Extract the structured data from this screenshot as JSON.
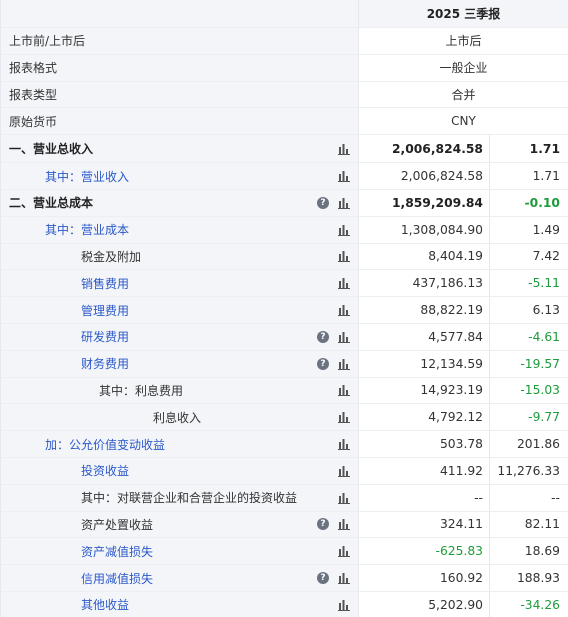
{
  "header": {
    "period": "2025 三季报"
  },
  "info_rows": [
    {
      "label": "上市前/上市后",
      "value": "上市后"
    },
    {
      "label": "报表格式",
      "value": "一般企业"
    },
    {
      "label": "报表类型",
      "value": "合并"
    },
    {
      "label": "原始货币",
      "value": "CNY"
    }
  ],
  "icons": {
    "chart": "bar-chart-icon",
    "help": "question-icon"
  },
  "colors": {
    "link": "#2b58c9",
    "negative": "#1e9b3a",
    "label_bg": "#f3f5f9"
  },
  "rows": [
    {
      "label": "一、营业总收入",
      "value": "2,006,824.58",
      "yoy": "1.71",
      "indent": 8,
      "style": "bold",
      "help": false,
      "neg": false
    },
    {
      "label": "其中：营业收入",
      "value": "2,006,824.58",
      "yoy": "1.71",
      "indent": 44,
      "style": "blue",
      "help": false,
      "neg": false
    },
    {
      "label": "二、营业总成本",
      "value": "1,859,209.84",
      "yoy": "-0.10",
      "indent": 8,
      "style": "bold",
      "help": true,
      "neg": true
    },
    {
      "label": "其中：营业成本",
      "value": "1,308,084.90",
      "yoy": "1.49",
      "indent": 44,
      "style": "blue",
      "help": false,
      "neg": false
    },
    {
      "label": "税金及附加",
      "value": "8,404.19",
      "yoy": "7.42",
      "indent": 80,
      "style": "plain",
      "help": false,
      "neg": false
    },
    {
      "label": "销售费用",
      "value": "437,186.13",
      "yoy": "-5.11",
      "indent": 80,
      "style": "blue",
      "help": false,
      "neg": true
    },
    {
      "label": "管理费用",
      "value": "88,822.19",
      "yoy": "6.13",
      "indent": 80,
      "style": "blue",
      "help": false,
      "neg": false
    },
    {
      "label": "研发费用",
      "value": "4,577.84",
      "yoy": "-4.61",
      "indent": 80,
      "style": "blue",
      "help": true,
      "neg": true
    },
    {
      "label": "财务费用",
      "value": "12,134.59",
      "yoy": "-19.57",
      "indent": 80,
      "style": "blue",
      "help": true,
      "neg": true
    },
    {
      "label": "其中：利息费用",
      "value": "14,923.19",
      "yoy": "-15.03",
      "indent": 98,
      "style": "plain",
      "help": false,
      "neg": true
    },
    {
      "label": "利息收入",
      "value": "4,792.12",
      "yoy": "-9.77",
      "indent": 152,
      "style": "plain",
      "help": false,
      "neg": true
    },
    {
      "label": "加：公允价值变动收益",
      "value": "503.78",
      "yoy": "201.86",
      "indent": 44,
      "style": "blue",
      "help": false,
      "neg": false
    },
    {
      "label": "投资收益",
      "value": "411.92",
      "yoy": "11,276.33",
      "indent": 80,
      "style": "blue",
      "help": false,
      "neg": false
    },
    {
      "label": "其中：对联营企业和合营企业的投资收益",
      "value": "--",
      "yoy": "--",
      "indent": 80,
      "style": "plain",
      "help": false,
      "neg": false
    },
    {
      "label": "资产处置收益",
      "value": "324.11",
      "yoy": "82.11",
      "indent": 80,
      "style": "plain",
      "help": true,
      "neg": false
    },
    {
      "label": "资产减值损失",
      "value": "-625.83",
      "yoy": "18.69",
      "indent": 80,
      "style": "blue",
      "help": false,
      "neg": false,
      "valneg": true
    },
    {
      "label": "信用减值损失",
      "value": "160.92",
      "yoy": "188.93",
      "indent": 80,
      "style": "blue",
      "help": true,
      "neg": false
    },
    {
      "label": "其他收益",
      "value": "5,202.90",
      "yoy": "-34.26",
      "indent": 80,
      "style": "blue",
      "help": false,
      "neg": true
    }
  ]
}
